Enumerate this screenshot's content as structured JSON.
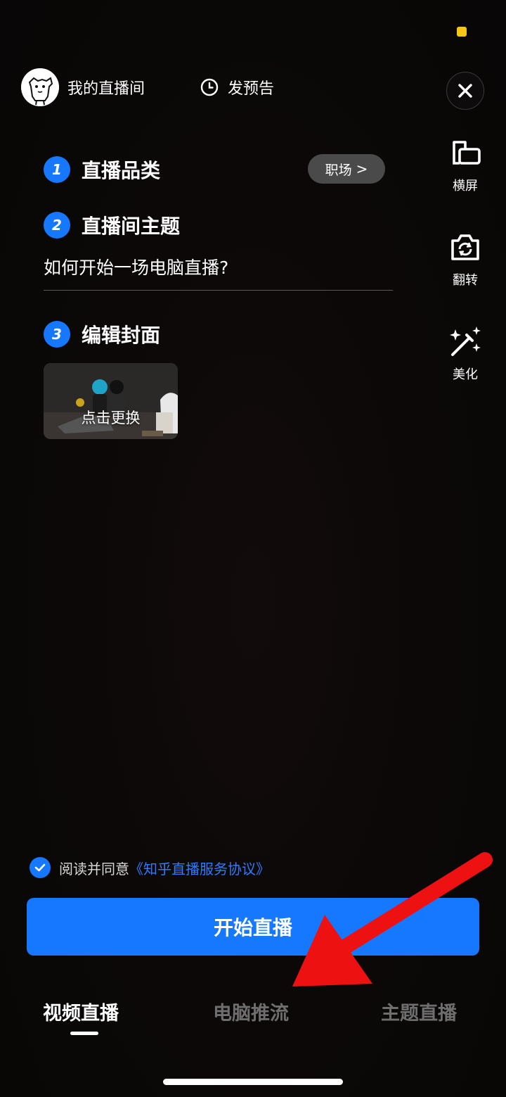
{
  "header": {
    "room_name": "我的直播间",
    "preview_label": "发预告"
  },
  "tools": [
    {
      "label": "横屏",
      "icon": "landscape-icon"
    },
    {
      "label": "翻转",
      "icon": "flip-camera-icon"
    },
    {
      "label": "美化",
      "icon": "beautify-wand-icon"
    }
  ],
  "steps": {
    "one": {
      "num": "1",
      "title": "直播品类"
    },
    "two": {
      "num": "2",
      "title": "直播间主题"
    },
    "three": {
      "num": "3",
      "title": "编辑封面"
    }
  },
  "category": {
    "value": "职场",
    "chevron": ">"
  },
  "topic": {
    "value": "如何开始一场电脑直播?"
  },
  "cover": {
    "label": "点击更换"
  },
  "agreement": {
    "text": "阅读并同意",
    "link": "《知乎直播服务协议》",
    "checked": true
  },
  "start_button": {
    "label": "开始直播"
  },
  "tabs": [
    {
      "label": "视频直播",
      "active": true
    },
    {
      "label": "电脑推流",
      "active": false
    },
    {
      "label": "主题直播",
      "active": false
    }
  ],
  "colors": {
    "accent": "#1677ff",
    "status_dot": "#f5c518",
    "annotation_arrow": "#ee1111"
  }
}
